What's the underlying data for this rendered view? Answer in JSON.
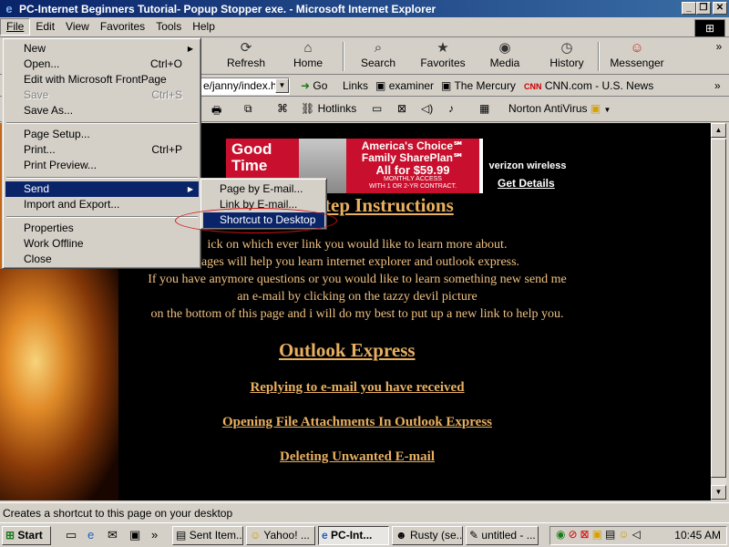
{
  "window": {
    "title": "PC-Internet Beginners Tutorial- Popup Stopper exe. - Microsoft Internet Explorer",
    "min": "_",
    "max": "❐",
    "close": "✕"
  },
  "menubar": [
    "File",
    "Edit",
    "View",
    "Favorites",
    "Tools",
    "Help"
  ],
  "toolbar": {
    "refresh": "Refresh",
    "home": "Home",
    "search": "Search",
    "favorites": "Favorites",
    "media": "Media",
    "history": "History",
    "messenger": "Messenger",
    "more": "»"
  },
  "address": {
    "value": "e/janny/index.ht",
    "go": "Go",
    "links_label": "Links",
    "links": [
      "examiner",
      "The Mercury",
      "CNN.com - U.S. News"
    ],
    "more": "»"
  },
  "linkbar": {
    "hotlinks": "Hotlinks",
    "norton": "Norton AntiVirus"
  },
  "file_menu": [
    {
      "label": "New",
      "arrow": true
    },
    {
      "label": "Open...",
      "shortcut": "Ctrl+O"
    },
    {
      "label": "Edit with Microsoft FrontPage"
    },
    {
      "label": "Save",
      "shortcut": "Ctrl+S",
      "disabled": true
    },
    {
      "label": "Save As..."
    },
    {
      "label": "Page Setup..."
    },
    {
      "label": "Print...",
      "shortcut": "Ctrl+P"
    },
    {
      "label": "Print Preview..."
    },
    {
      "label": "Send",
      "arrow": true,
      "selected": true
    },
    {
      "label": "Import and Export..."
    },
    {
      "label": "Properties"
    },
    {
      "label": "Work Offline"
    },
    {
      "label": "Close"
    }
  ],
  "send_submenu": [
    "Page by E-mail...",
    "Link by E-mail...",
    "Shortcut to Desktop"
  ],
  "banner": {
    "left": "Good Time",
    "line1": "America's Choice℠",
    "line2": "Family SharePlan℠",
    "line3": "All for $59.99",
    "line4": "MONTHLY ACCESS",
    "line5": "WITH 1 OR 2-YR CONTRACT.",
    "brand": "verizon wireless",
    "details": "Get Details"
  },
  "content": {
    "heading": "tep Instructions",
    "para": [
      "ick on which ever link you would like to learn more about.",
      "pages will help you  learn internet explorer  and outlook express.",
      "If you have anymore questions or you would like to learn something new send me",
      "an e-mail by clicking on the tazzy devil picture",
      "on the bottom of this page and i will do my best to put up a new link to help you."
    ],
    "section": "Outlook Express",
    "links": [
      "Replying to e-mail you have received",
      "Opening File Attachments In Outlook Express",
      "Deleting Unwanted E-mail"
    ]
  },
  "status": "Creates a shortcut to this page on your desktop",
  "taskbar": {
    "start": "Start",
    "more": "»",
    "tasks": [
      "Sent Item...",
      "Yahoo! ...",
      "PC-Int...",
      "Rusty (se...",
      "untitled - ..."
    ],
    "active_task": 2,
    "clock": "10:45 AM"
  },
  "colors": {
    "titlebar": "#0a246a",
    "highlight": "#0a246a",
    "link": "#e8b060",
    "page_bg": "#000000",
    "annotation": "#d01010"
  }
}
